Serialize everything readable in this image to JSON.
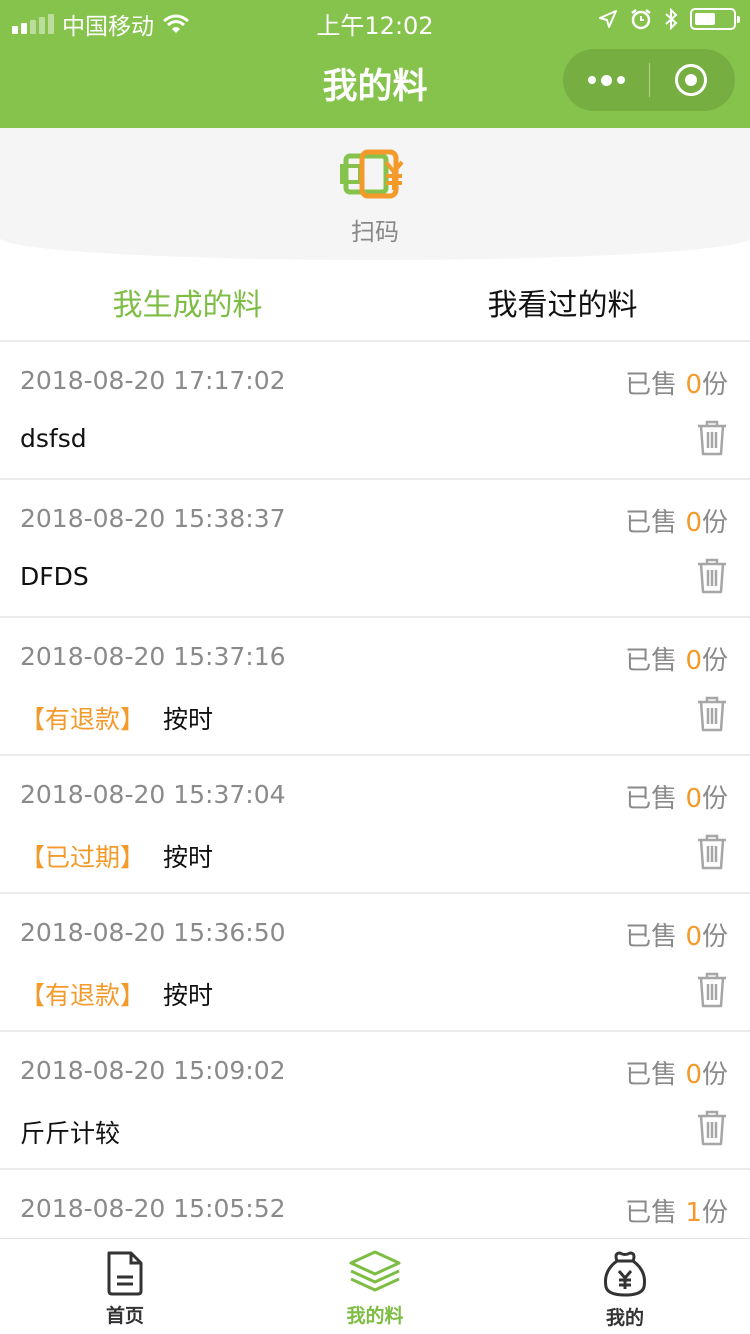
{
  "status_bar": {
    "carrier": "中国移动",
    "time": "上午12:02",
    "battery_level": 0.55
  },
  "nav": {
    "title": "我的料"
  },
  "scan": {
    "label": "扫码",
    "icon": "scan-yuan-icon"
  },
  "tabs": [
    {
      "label": "我生成的料",
      "active": true
    },
    {
      "label": "我看过的料",
      "active": false
    }
  ],
  "sold_prefix": "已售",
  "sold_suffix": "份",
  "items": [
    {
      "date": "2018-08-20 17:17:02",
      "sold": "0",
      "tag": "",
      "name": "dsfsd"
    },
    {
      "date": "2018-08-20 15:38:37",
      "sold": "0",
      "tag": "",
      "name": "DFDS"
    },
    {
      "date": "2018-08-20 15:37:16",
      "sold": "0",
      "tag": "【有退款】",
      "name": "按时"
    },
    {
      "date": "2018-08-20 15:37:04",
      "sold": "0",
      "tag": "【已过期】",
      "name": "按时"
    },
    {
      "date": "2018-08-20 15:36:50",
      "sold": "0",
      "tag": "【有退款】",
      "name": "按时"
    },
    {
      "date": "2018-08-20 15:09:02",
      "sold": "0",
      "tag": "",
      "name": "斤斤计较"
    },
    {
      "date": "2018-08-20 15:05:52",
      "sold": "1",
      "tag": "",
      "name": ""
    }
  ],
  "tabbar": [
    {
      "label": "首页",
      "icon": "document-icon",
      "active": false
    },
    {
      "label": "我的料",
      "icon": "layers-icon",
      "active": true
    },
    {
      "label": "我的",
      "icon": "money-bag-icon",
      "active": false
    }
  ],
  "colors": {
    "brand_green": "#86c34c",
    "accent_orange": "#f39a2b",
    "muted_gray": "#8a8a8a"
  }
}
